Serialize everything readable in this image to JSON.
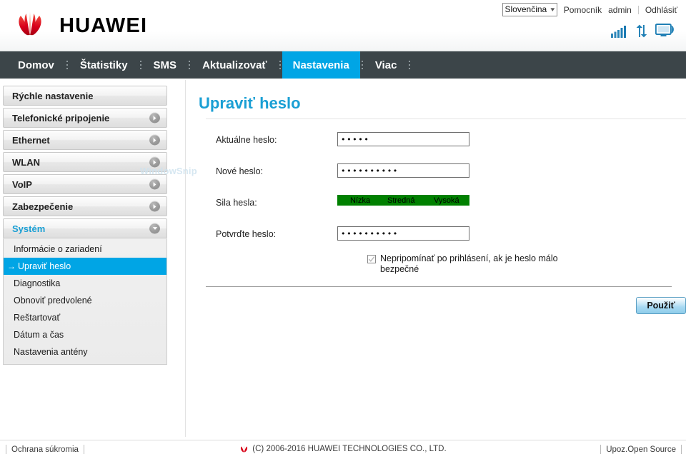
{
  "brand": {
    "name": "HUAWEI",
    "logo_color": "#e2001a",
    "accent_color": "#00a5e5",
    "nav_bg": "#3c4549"
  },
  "header": {
    "language": {
      "selected": "Slovenčina",
      "icon": "chevron-down-icon"
    },
    "links": [
      {
        "label": "Pomocník",
        "name": "help-link"
      },
      {
        "label": "admin",
        "name": "user-link"
      },
      {
        "label": "Odhlásiť",
        "name": "logout-link"
      }
    ],
    "status_icons": [
      {
        "name": "signal-bars-icon",
        "title": "signal"
      },
      {
        "name": "data-transfer-icon",
        "title": "upload-download"
      },
      {
        "name": "connected-device-icon",
        "title": "monitor-wifi"
      }
    ]
  },
  "nav": {
    "items": [
      {
        "label": "Domov",
        "active": false
      },
      {
        "label": "Štatistiky",
        "active": false
      },
      {
        "label": "SMS",
        "active": false
      },
      {
        "label": "Aktualizovať",
        "active": false
      },
      {
        "label": "Nastavenia",
        "active": true
      },
      {
        "label": "Viac",
        "active": false
      }
    ]
  },
  "sidebar": {
    "items": [
      {
        "label": "Rýchle nastavenie",
        "has_arrow": false,
        "open": false
      },
      {
        "label": "Telefonické pripojenie",
        "has_arrow": true,
        "open": false
      },
      {
        "label": "Ethernet",
        "has_arrow": true,
        "open": false
      },
      {
        "label": "WLAN",
        "has_arrow": true,
        "open": false
      },
      {
        "label": "VoIP",
        "has_arrow": true,
        "open": false
      },
      {
        "label": "Zabezpečenie",
        "has_arrow": true,
        "open": false
      },
      {
        "label": "Systém",
        "has_arrow": true,
        "open": true
      }
    ],
    "submenu": [
      {
        "label": "Informácie o zariadení",
        "active": false
      },
      {
        "label": "Upraviť heslo",
        "active": true,
        "marker": "→"
      },
      {
        "label": "Diagnostika",
        "active": false
      },
      {
        "label": "Obnoviť predvolené",
        "active": false
      },
      {
        "label": "Reštartovať",
        "active": false
      },
      {
        "label": "Dátum a čas",
        "active": false
      },
      {
        "label": "Nastavenia antény",
        "active": false
      }
    ]
  },
  "main": {
    "title": "Upraviť heslo",
    "fields": {
      "current_password": {
        "label": "Aktuálne heslo:",
        "value": "•••••",
        "placeholder": ""
      },
      "new_password": {
        "label": "Nové heslo:",
        "value": "••••••••••",
        "placeholder": ""
      },
      "confirm_password": {
        "label": "Potvrďte heslo:",
        "value": "••••••••••",
        "placeholder": ""
      }
    },
    "strength": {
      "label": "Sila hesla:",
      "bar_color": "#008000",
      "fill_percent": 100,
      "ticks": [
        "Nízka",
        "Stredná",
        "Vysoká"
      ]
    },
    "checkbox": {
      "checked": true,
      "label": "Nepripomínať po prihlásení, ak je heslo málo bezpečné"
    },
    "apply_button": "Použiť"
  },
  "footer": {
    "left": "Ochrana súkromia",
    "center": "(C) 2006-2016 HUAWEI TECHNOLOGIES CO., LTD.",
    "right": "Upoz.Open Source"
  },
  "artifact": {
    "watermark": "WindowSnip"
  }
}
